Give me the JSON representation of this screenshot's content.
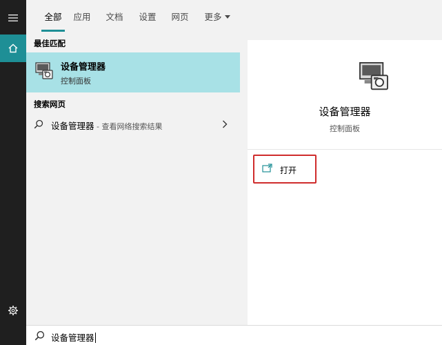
{
  "rail": {
    "menu_icon": "hamburger-icon",
    "home_icon": "home-icon",
    "settings_icon": "gear-icon"
  },
  "tabs": [
    {
      "label": "全部",
      "active": true
    },
    {
      "label": "应用"
    },
    {
      "label": "文档"
    },
    {
      "label": "设置"
    },
    {
      "label": "网页"
    },
    {
      "label": "更多",
      "has_dropdown": true
    }
  ],
  "left": {
    "best_match_heading": "最佳匹配",
    "best_match": {
      "title": "设备管理器",
      "subtitle": "控制面板",
      "icon": "device-manager-icon"
    },
    "web_heading": "搜索网页",
    "web_result": {
      "query": "设备管理器",
      "suffix": " - 查看网络搜索结果",
      "icon": "search-icon",
      "arrow_icon": "chevron-right-icon"
    }
  },
  "detail": {
    "title": "设备管理器",
    "subtitle": "控制面板",
    "icon": "device-manager-icon",
    "open_label": "打开",
    "open_icon": "open-window-icon"
  },
  "search": {
    "value": "设备管理器",
    "icon": "search-icon"
  },
  "colors": {
    "accent": "#1e8f96",
    "selection": "#a8e1e6",
    "rail": "#1f1f1f",
    "highlight_box": "#cf2b2b"
  }
}
